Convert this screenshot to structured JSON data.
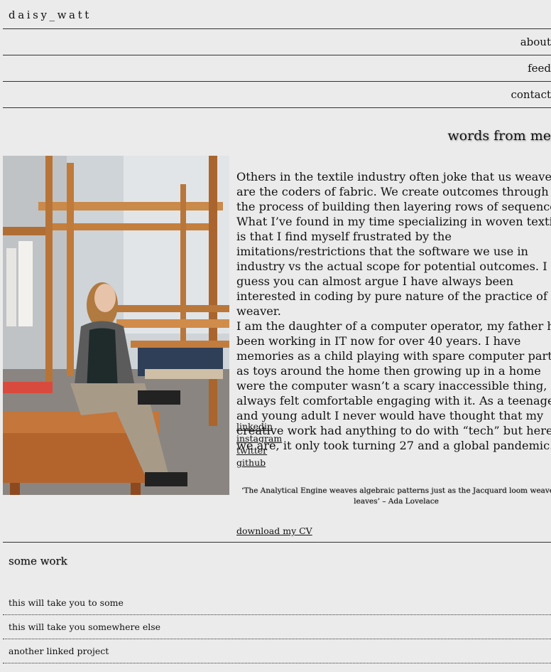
{
  "site": {
    "brand": "daisy_watt"
  },
  "nav": {
    "about": "about",
    "feed": "feed",
    "contact": "contact"
  },
  "intro": {
    "title": "words from me",
    "paragraphs": [
      "Others in the textile industry often joke that us weavers are the coders of fabric. We create outcomes through the process of building then layering rows of sequence. What I’ve found in my time specializing in woven textiles is that I find myself frustrated by the imitations/restrictions that the software we use in industry vs the actual scope for potential outcomes. I guess you can almost argue I have always been interested in coding by pure nature of the practice of a weaver.",
      "I am the daughter of a computer operator, my father has been working in IT now for over 40 years. I have memories as a child playing with spare computer parts as toys around the home then growing up in a home were the computer wasn’t a scary inaccessible thing, ive always felt comfortable engaging with it. As a teenager and young adult I never would have thought that my creative work had anything to do with “tech” but here we are, it only took turning 27 and a global pandemic."
    ],
    "links": [
      "linkedin",
      "instagram",
      "twitter",
      "github"
    ],
    "quote_line1": "‘The Analytical Engine weaves algebraic patterns just as the Jacquard loom weaves flowers and",
    "quote_line2": "leaves’ – Ada Lovelace",
    "cv_label": "download my CV"
  },
  "work": {
    "title": "some work",
    "projects": [
      "this will take you to some",
      "this will take you somewhere else",
      "another linked project"
    ]
  },
  "colors": {
    "background": "#ebebeb",
    "text": "#111111",
    "rule": "#333333"
  }
}
